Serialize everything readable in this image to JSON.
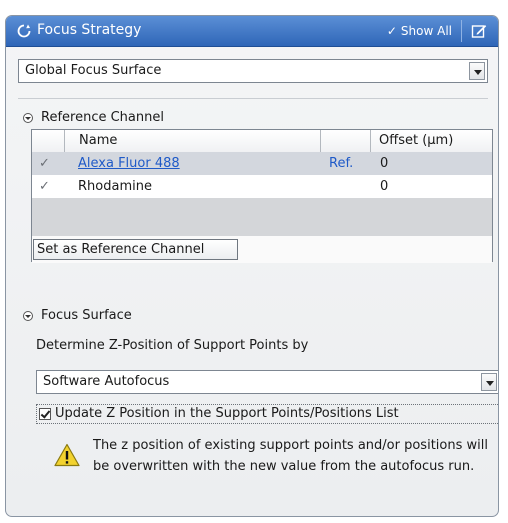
{
  "panel": {
    "title": "Focus Strategy",
    "show_all_label": "Show All",
    "title_icon": "refresh-icon",
    "edit_icon": "edit-icon"
  },
  "strategy": {
    "selected": "Global Focus Surface"
  },
  "reference_channel": {
    "heading": "Reference Channel",
    "columns": [
      "Name",
      "Offset (µm)"
    ],
    "rows": [
      {
        "name": "Alexa Fluor 488",
        "ref": "Ref.",
        "offset": "0"
      },
      {
        "name": "Rhodamine",
        "ref": "",
        "offset": "0"
      }
    ],
    "set_button": "Set as Reference Channel"
  },
  "focus_surface": {
    "heading": "Focus Surface",
    "determine_label": "Determine Z-Position of Support Points by",
    "method_selected": "Software Autofocus",
    "update_checkbox_label": "Update Z Position in the Support Points/Positions List",
    "update_checked": true,
    "warning_text": "The z position of existing support points and/or positions will be overwritten with the new value from the autofocus run."
  },
  "colors": {
    "title_bar": "#3a73c6",
    "link": "#1f5ac8",
    "warning": "#f2d22e"
  }
}
